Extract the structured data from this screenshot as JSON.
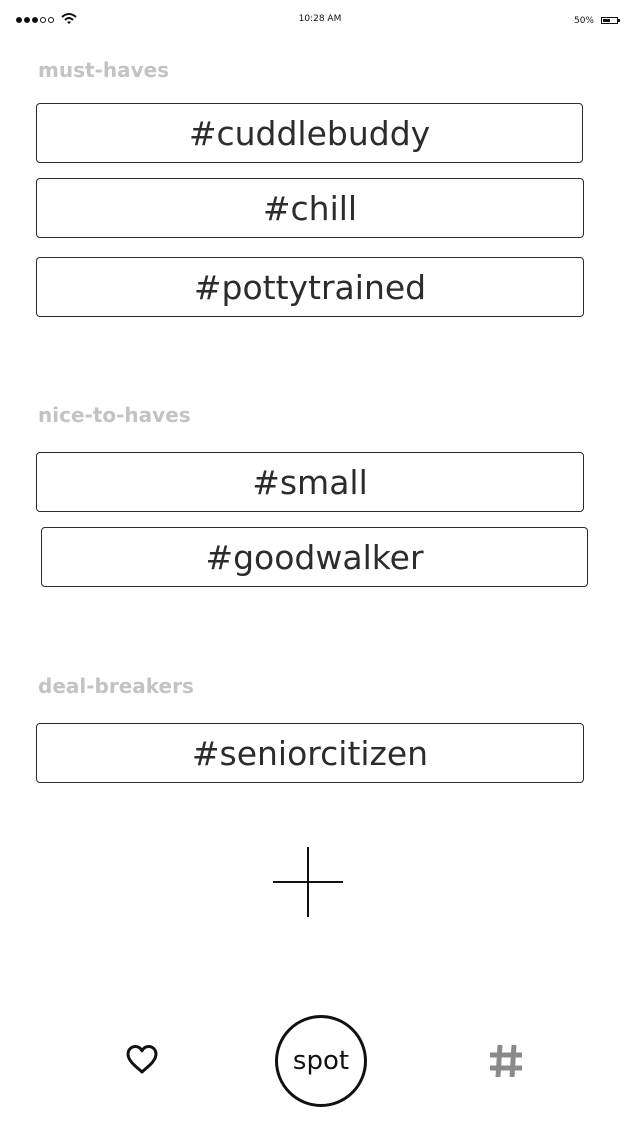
{
  "status_bar": {
    "time": "10:28 AM",
    "battery_percent": "50%",
    "battery_level": 0.5,
    "signal_bars_filled": 3,
    "signal_bars_total": 5
  },
  "sections": {
    "must_haves": {
      "heading": "must-haves",
      "tags": [
        "#cuddlebuddy",
        "#chill",
        "#pottytrained"
      ]
    },
    "nice_to_haves": {
      "heading": "nice-to-haves",
      "tags": [
        "#small",
        "#goodwalker"
      ]
    },
    "deal_breakers": {
      "heading": "deal-breakers",
      "tags": [
        "#seniorcitizen"
      ]
    }
  },
  "bottom_nav": {
    "left_icon": "heart-icon",
    "center_label": "spot",
    "right_icon": "hash-icon"
  },
  "add_button_icon": "plus-icon",
  "colors": {
    "heading": "#c3c3c3",
    "text": "#2c2c2c",
    "hash_icon": "#8a8a8a"
  }
}
